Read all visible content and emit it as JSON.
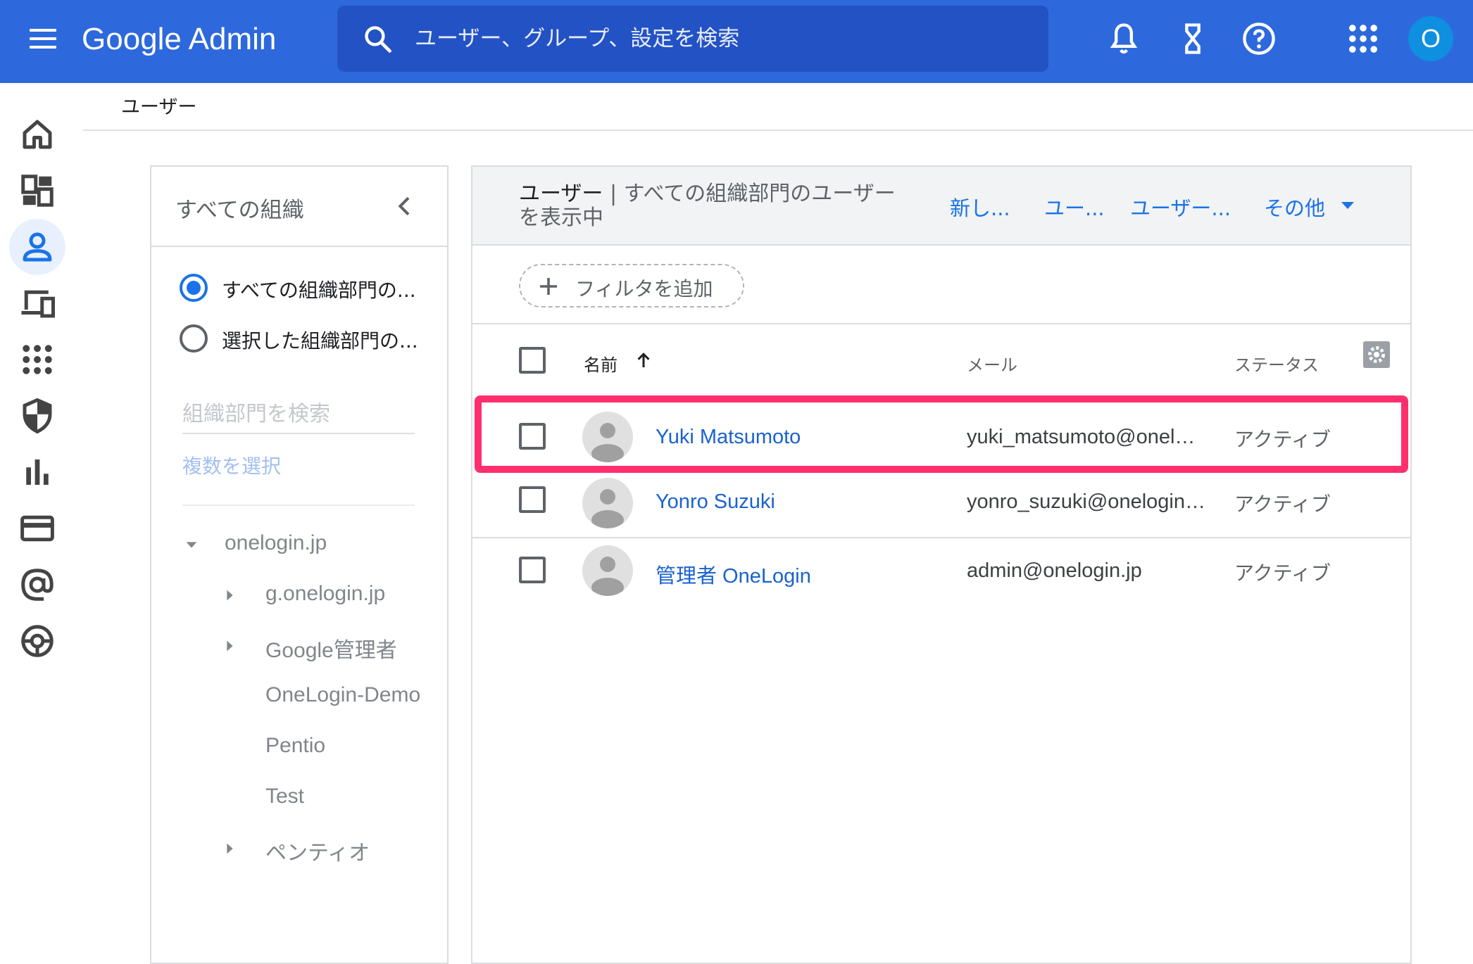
{
  "topbar": {
    "brand": "Google Admin",
    "search_placeholder": "ユーザー、グループ、設定を検索",
    "icons": [
      "menu-icon",
      "search-icon",
      "bell-icon",
      "hourglass-icon",
      "help-icon",
      "apps-grid-icon"
    ],
    "account_initial": "O",
    "accent_color": "#2d69dc"
  },
  "rail": {
    "items": [
      "home-icon",
      "dashboard-icon",
      "user-icon",
      "devices-icon",
      "apps-icon",
      "security-shield-icon",
      "reports-icon",
      "billing-card-icon",
      "at-sign-icon",
      "support-lifebuoy-icon"
    ],
    "active_item": "user-icon"
  },
  "breadcrumb": "ユーザー",
  "org_panel": {
    "title": "すべての組織",
    "radio_options": [
      {
        "label": "すべての組織部門の...",
        "checked": true
      },
      {
        "label": "選択した組織部門の...",
        "checked": false
      }
    ],
    "search_placeholder": "組織部門を検索",
    "multi_select": "複数を選択",
    "tree": [
      {
        "label": "onelogin.jp",
        "expanded": true,
        "has_children": true
      },
      {
        "label": "g.onelogin.jp",
        "has_children": true
      },
      {
        "label": "Google管理者",
        "has_children": true
      },
      {
        "label": "OneLogin-Demo",
        "has_children": false
      },
      {
        "label": "Pentio",
        "has_children": false
      },
      {
        "label": "Test",
        "has_children": false
      },
      {
        "label": "ペンティオ",
        "has_children": true
      }
    ]
  },
  "users_panel": {
    "title": "ユーザー",
    "separator": " | ",
    "subtitle": "すべての組織部門のユーザーを表示中",
    "actions": [
      "新し...",
      "ユー...",
      "ユーザー...",
      "その他"
    ],
    "filter_button": "フィルタを追加",
    "columns": {
      "name": "名前",
      "email": "メール",
      "status": "ステータス"
    },
    "sort": "ascending",
    "users": [
      {
        "name": "Yuki Matsumoto",
        "email": "yuki_matsumoto@onelog...",
        "status": "アクティブ",
        "highlighted": true
      },
      {
        "name": "Yonro Suzuki",
        "email": "yonro_suzuki@onelogin.jp",
        "status": "アクティブ",
        "highlighted": false
      },
      {
        "name": "管理者 OneLogin",
        "email": "admin@onelogin.jp",
        "status": "アクティブ",
        "highlighted": false
      }
    ],
    "highlight_color": "#ff2f6e",
    "link_color": "#1a62d0"
  }
}
